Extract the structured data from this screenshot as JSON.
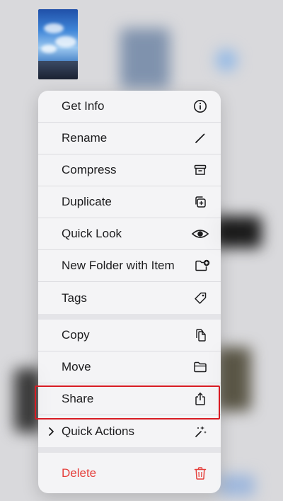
{
  "menu": {
    "items": [
      {
        "label": "Get Info",
        "icon": "info-icon"
      },
      {
        "label": "Rename",
        "icon": "pencil-icon"
      },
      {
        "label": "Compress",
        "icon": "archive-box-icon"
      },
      {
        "label": "Duplicate",
        "icon": "duplicate-icon"
      },
      {
        "label": "Quick Look",
        "icon": "eye-icon"
      },
      {
        "label": "New Folder with Item",
        "icon": "folder-plus-icon"
      },
      {
        "label": "Tags",
        "icon": "tag-icon"
      },
      {
        "label": "Copy",
        "icon": "copy-documents-icon"
      },
      {
        "label": "Move",
        "icon": "folder-icon"
      },
      {
        "label": "Share",
        "icon": "share-icon"
      },
      {
        "label": "Quick Actions",
        "icon": "sparkle-wand-icon"
      },
      {
        "label": "Delete",
        "icon": "trash-icon"
      }
    ]
  },
  "colors": {
    "destructive": "#e5403c",
    "highlight_border": "#d81c24"
  }
}
